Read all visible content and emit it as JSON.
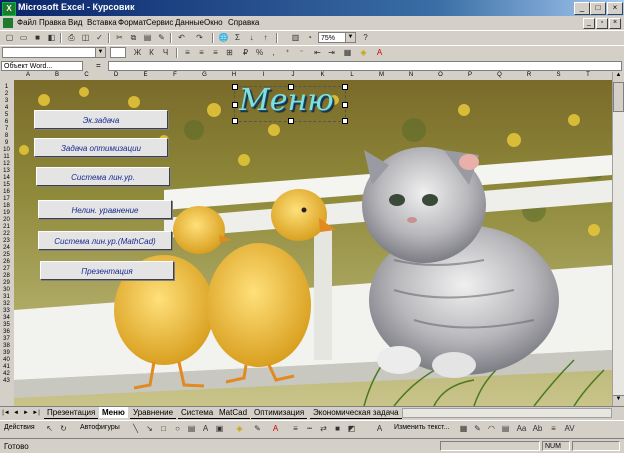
{
  "window": {
    "title": "Microsoft Excel - Курсовик"
  },
  "menu": [
    "Файл",
    "Правка",
    "Вид",
    "Вставка",
    "Формат",
    "Сервис",
    "Данные",
    "Окно",
    "Справка"
  ],
  "toolbar": {
    "zoom": "75%",
    "help": "?"
  },
  "formula_bar": {
    "name_box": "Объект Word...",
    "eq": "="
  },
  "columns": [
    "A",
    "B",
    "C",
    "D",
    "E",
    "F",
    "G",
    "H",
    "I",
    "J",
    "K",
    "L",
    "M",
    "N",
    "O",
    "P",
    "Q",
    "R",
    "S",
    "T"
  ],
  "rows": [
    "1",
    "2",
    "3",
    "4",
    "5",
    "6",
    "7",
    "8",
    "9",
    "10",
    "11",
    "12",
    "13",
    "14",
    "15",
    "16",
    "17",
    "18",
    "19",
    "20",
    "21",
    "22",
    "23",
    "24",
    "25",
    "26",
    "27",
    "28",
    "29",
    "30",
    "31",
    "32",
    "33",
    "34",
    "35",
    "36",
    "37",
    "38",
    "39",
    "40",
    "41",
    "42",
    "43"
  ],
  "wordart": {
    "text": "Меню"
  },
  "sheet_buttons": [
    "Эк.задача",
    "Задача оптимизации",
    "Система лин.ур.",
    "Нелин. уравнение",
    "Система лин.ур.(MathCad)",
    "Презентация"
  ],
  "tabs": [
    "Презентация",
    "Меню",
    "Уравнение",
    "Система",
    "MatCad",
    "Оптимизация",
    "Экономическая задача"
  ],
  "active_tab": "Меню",
  "drawing": {
    "actions": "Действия",
    "autoshapes": "Автофигуры",
    "change_text": "Изменить текст..."
  },
  "status": {
    "ready": "Готово",
    "num": "NUM"
  },
  "colors": {
    "titlebar": "#0a246a",
    "button_text": "#1a2b8f",
    "wordart": "#7fe0e0"
  }
}
